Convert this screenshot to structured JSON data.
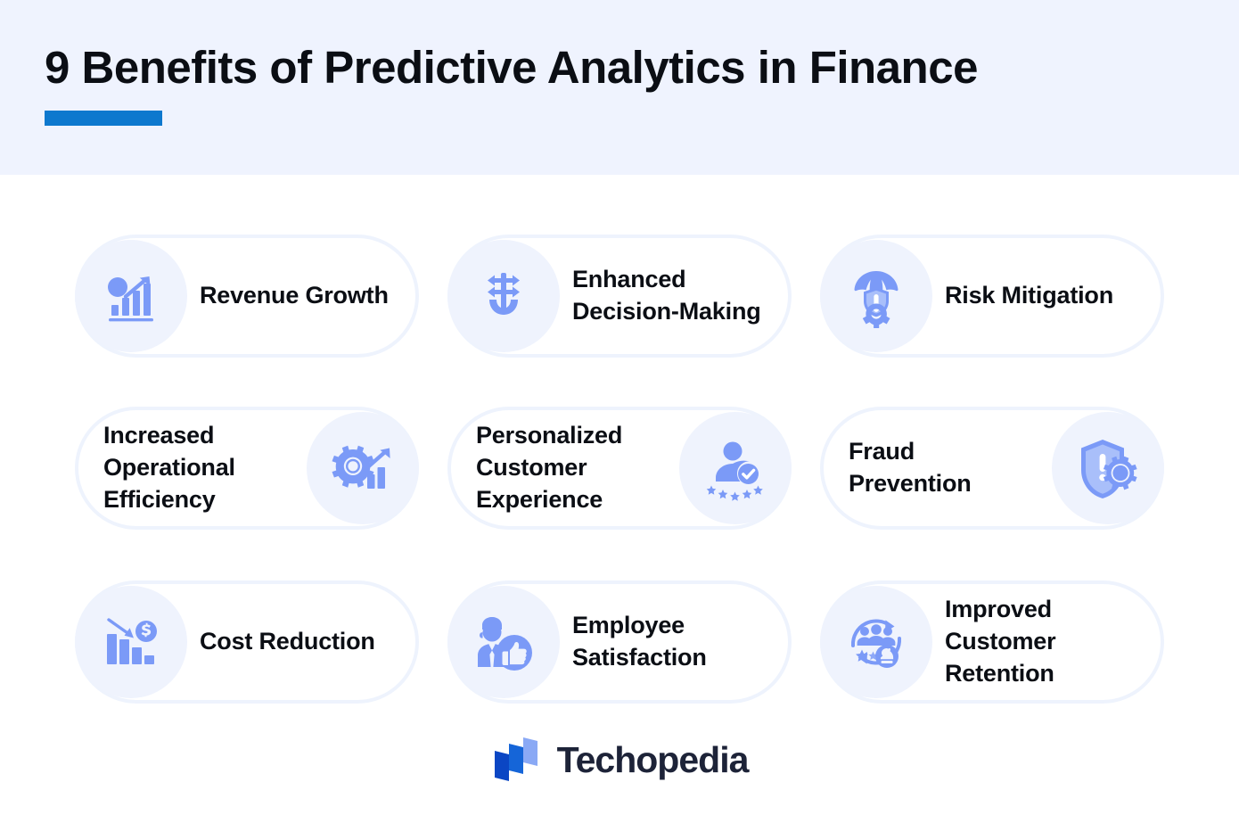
{
  "header": {
    "title": "9 Benefits of Predictive Analytics in Finance",
    "accent_color": "#0d78ce",
    "background_color": "#eff3fe"
  },
  "theme": {
    "page_background": "#ffffff",
    "card_background": "#ffffff",
    "card_border_color": "#eef3fd",
    "icon_circle_background": "#eff3fd",
    "icon_color": "#7b9af7",
    "text_color": "#0b0e14"
  },
  "benefits": [
    {
      "label": "Revenue Growth",
      "icon": "bar-chart-growth-dollar-icon",
      "icon_side": "left"
    },
    {
      "label": "Enhanced Decision-Making",
      "icon": "anchor-arrows-gear-icon",
      "icon_side": "left"
    },
    {
      "label": "Risk Mitigation",
      "icon": "umbrella-shield-alert-gear-icon",
      "icon_side": "left"
    },
    {
      "label": "Increased Operational Efficiency",
      "icon": "gear-bar-chart-arrow-icon",
      "icon_side": "right"
    },
    {
      "label": "Personalized Customer Experience",
      "icon": "person-check-stars-icon",
      "icon_side": "right"
    },
    {
      "label": "Fraud Prevention",
      "icon": "shield-alert-gear-icon",
      "icon_side": "right"
    },
    {
      "label": "Cost Reduction",
      "icon": "bar-chart-decline-dollar-icon",
      "icon_side": "left"
    },
    {
      "label": "Employee Satisfaction",
      "icon": "employee-thumbs-up-icon",
      "icon_side": "left"
    },
    {
      "label": "Improved Customer Retention",
      "icon": "retention-loop-people-icon",
      "icon_side": "left"
    }
  ],
  "footer": {
    "brand": "Techopedia",
    "logo_colors": [
      "#0b46c4",
      "#1565d8",
      "#8aa9f5"
    ]
  }
}
